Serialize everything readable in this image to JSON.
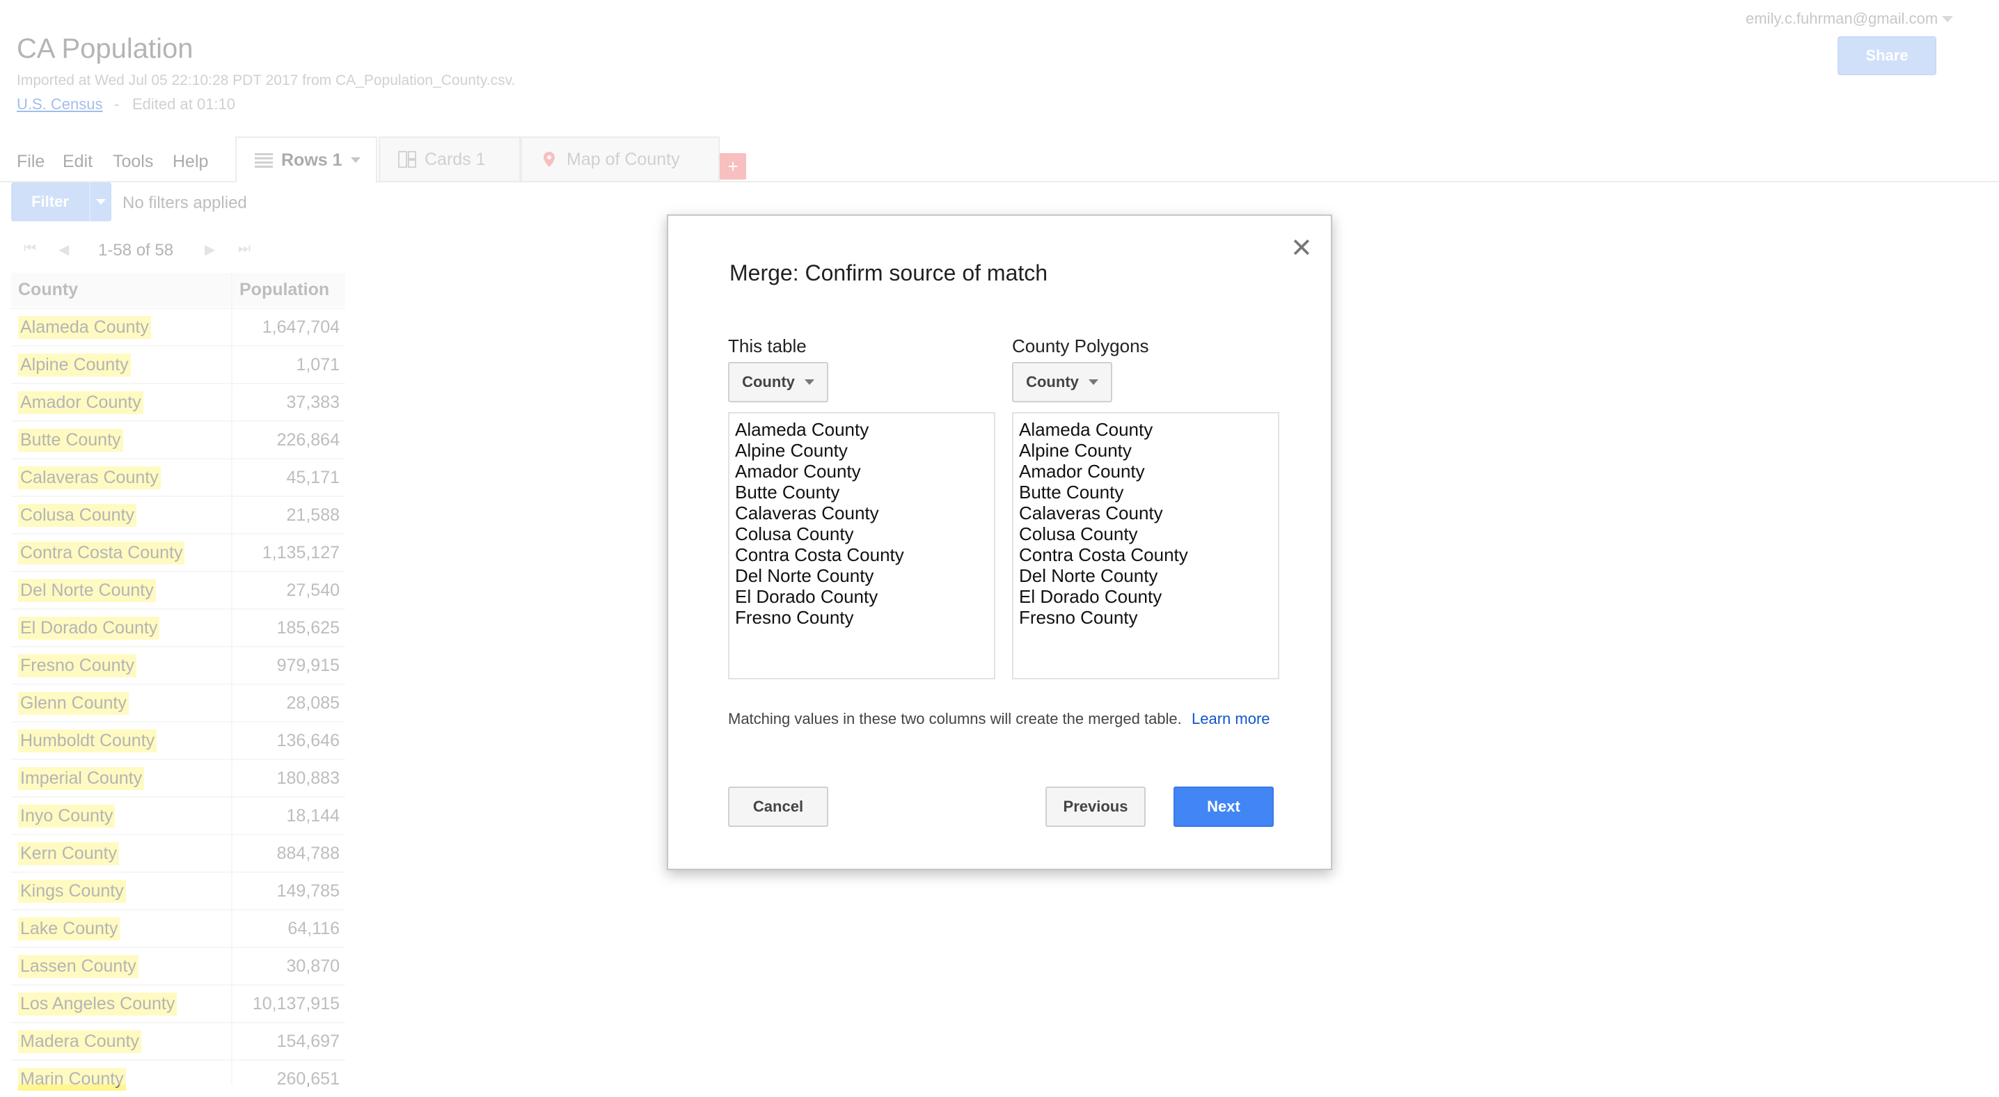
{
  "header": {
    "title": "CA Population",
    "imported": "Imported at Wed Jul 05 22:10:28 PDT 2017 from CA_Population_County.csv.",
    "source_link": "U.S. Census",
    "separator": "-",
    "edited": "Edited at 01:10",
    "user_email": "emily.c.fuhrman@gmail.com",
    "share_label": "Share"
  },
  "menu": [
    "File",
    "Edit",
    "Tools",
    "Help"
  ],
  "tabs": [
    {
      "label": "Rows 1",
      "icon": "rows-icon",
      "active": true
    },
    {
      "label": "Cards 1",
      "icon": "cards-icon",
      "active": false
    },
    {
      "label": "Map of County",
      "icon": "map-pin-icon",
      "active": false
    }
  ],
  "tab_add_label": "+",
  "filter": {
    "button_label": "Filter",
    "status": "No filters applied"
  },
  "pager": {
    "text": "1-58 of 58"
  },
  "table": {
    "headers": {
      "county": "County",
      "population": "Population"
    },
    "rows": [
      {
        "county": "Alameda County",
        "population": "1,647,704"
      },
      {
        "county": "Alpine County",
        "population": "1,071"
      },
      {
        "county": "Amador County",
        "population": "37,383"
      },
      {
        "county": "Butte County",
        "population": "226,864"
      },
      {
        "county": "Calaveras County",
        "population": "45,171"
      },
      {
        "county": "Colusa County",
        "population": "21,588"
      },
      {
        "county": "Contra Costa County",
        "population": "1,135,127"
      },
      {
        "county": "Del Norte County",
        "population": "27,540"
      },
      {
        "county": "El Dorado County",
        "population": "185,625"
      },
      {
        "county": "Fresno County",
        "population": "979,915"
      },
      {
        "county": "Glenn County",
        "population": "28,085"
      },
      {
        "county": "Humboldt County",
        "population": "136,646"
      },
      {
        "county": "Imperial County",
        "population": "180,883"
      },
      {
        "county": "Inyo County",
        "population": "18,144"
      },
      {
        "county": "Kern County",
        "population": "884,788"
      },
      {
        "county": "Kings County",
        "population": "149,785"
      },
      {
        "county": "Lake County",
        "population": "64,116"
      },
      {
        "county": "Lassen County",
        "population": "30,870"
      },
      {
        "county": "Los Angeles County",
        "population": "10,137,915"
      },
      {
        "county": "Madera County",
        "population": "154,697"
      },
      {
        "county": "Marin County",
        "population": "260,651"
      }
    ]
  },
  "dialog": {
    "title": "Merge: Confirm source of match",
    "close_label": "✕",
    "left": {
      "label": "This table",
      "column": "County",
      "values": [
        "Alameda County",
        "Alpine County",
        "Amador County",
        "Butte County",
        "Calaveras County",
        "Colusa County",
        "Contra Costa County",
        "Del Norte County",
        "El Dorado County",
        "Fresno County"
      ]
    },
    "right": {
      "label": "County Polygons",
      "column": "County",
      "values": [
        "Alameda County",
        "Alpine County",
        "Amador County",
        "Butte County",
        "Calaveras County",
        "Colusa County",
        "Contra Costa County",
        "Del Norte County",
        "El Dorado County",
        "Fresno County"
      ]
    },
    "hint": "Matching values in these two columns will create the merged table.",
    "learn_more": "Learn more",
    "cancel_label": "Cancel",
    "previous_label": "Previous",
    "next_label": "Next"
  }
}
